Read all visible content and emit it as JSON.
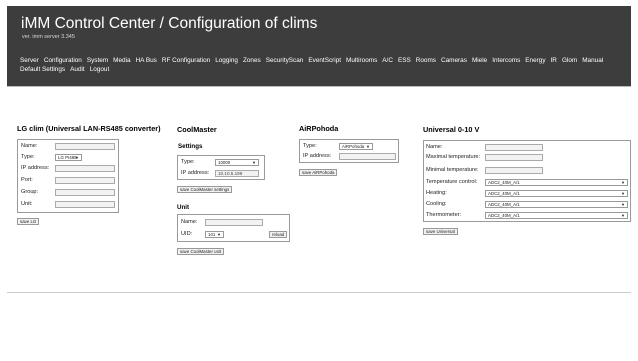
{
  "header": {
    "title": "iMM Control Center / Configuration of clims",
    "version": "ver. imm server 3.345"
  },
  "menu": [
    "Server",
    "Configuration",
    "System",
    "Media",
    "HA Bus",
    "RF Configuration",
    "Logging",
    "Zones",
    "SecurityScan",
    "EventScript",
    "Multirooms",
    "A/C",
    "ESS",
    "Rooms",
    "Cameras",
    "Miele",
    "Intercoms",
    "Energy",
    "IR",
    "Glom",
    "Manual",
    "Default Settings",
    "Audit",
    "Logout"
  ],
  "lg": {
    "heading": "LG clim (Universal LAN-RS485 converter)",
    "name_label": "Name:",
    "type_label": "Type:",
    "type_value": "LG PI485",
    "ip_label": "IP address:",
    "port_label": "Port:",
    "group_label": "Group:",
    "unit_label": "Unit:",
    "save": "save LG"
  },
  "coolmaster": {
    "heading": "CoolMaster",
    "settings_heading": "Settings",
    "type_label": "Type:",
    "type_value": "10000",
    "ip_label": "IP address:",
    "ip_value": "10.10.5.199",
    "save_settings": "save CoolMaster settings",
    "unit_heading": "Unit",
    "name_label": "Name:",
    "uid_label": "UID:",
    "uid_value": "101",
    "reload": "reload",
    "save_unit": "save CoolMaster unit"
  },
  "airpohoda": {
    "heading": "AiRPohoda",
    "type_label": "Type:",
    "type_value": "AiRPohoda",
    "ip_label": "IP address:",
    "save": "save AiRPohoda"
  },
  "universal": {
    "heading": "Universal 0-10 V",
    "name_label": "Name:",
    "max_label": "Maximal temperature:",
    "min_label": "Minimal temperature:",
    "tc_label": "Temperature control:",
    "tc_value": "ADC2_40M_A/1",
    "heating_label": "Heating:",
    "heating_value": "ADC2_40M_A/1",
    "cooling_label": "Cooling:",
    "cooling_value": "ADC2_40M_A/1",
    "thermo_label": "Thermometer:",
    "thermo_value": "ADC2_40M_A/1",
    "save": "save Universal"
  },
  "colors": {
    "header_bg": "#3d3d3d",
    "header_text": "#ffffff"
  }
}
